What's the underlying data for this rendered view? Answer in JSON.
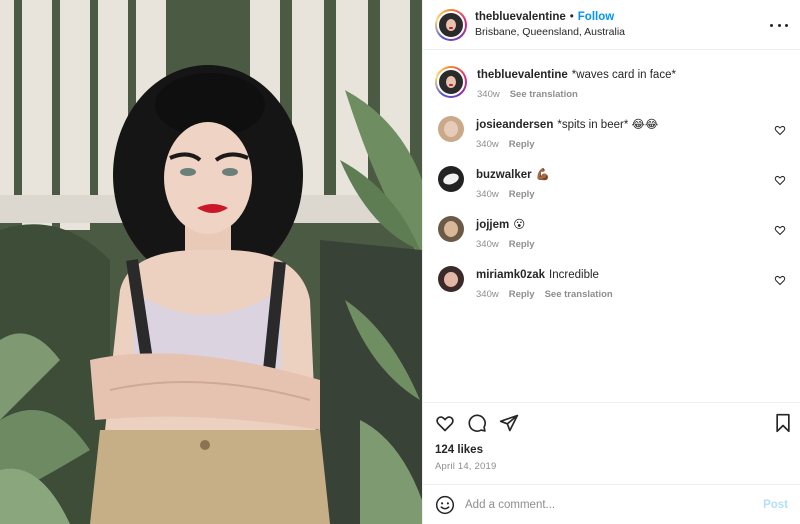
{
  "post": {
    "author": "thebluevalentine",
    "follow_label": "Follow",
    "separator": "•",
    "location": "Brisbane, Queensland, Australia",
    "caption_text": "*waves card in face*",
    "caption_age": "340w",
    "caption_translate": "See translation"
  },
  "comments": [
    {
      "user": "josieandersen",
      "text": "*spits in beer* 😂😂",
      "age": "340w",
      "reply": "Reply",
      "translate": ""
    },
    {
      "user": "buzwalker",
      "text": "💪🏾",
      "age": "340w",
      "reply": "Reply",
      "translate": ""
    },
    {
      "user": "jojjem",
      "text": "😮",
      "age": "340w",
      "reply": "Reply",
      "translate": ""
    },
    {
      "user": "miriamk0zak",
      "text": "Incredible",
      "age": "340w",
      "reply": "Reply",
      "translate": "See translation"
    }
  ],
  "engagement": {
    "likes": "124 likes",
    "date": "April 14, 2019"
  },
  "composer": {
    "placeholder": "Add a comment...",
    "post_label": "Post"
  },
  "icons": [
    "more-icon",
    "heart-icon",
    "comment-icon",
    "share-icon",
    "bookmark-icon",
    "emoji-icon"
  ],
  "colors": {
    "follow": "#0095f6",
    "post_disabled": "#b2dffc",
    "muted": "#8e8e8e"
  }
}
